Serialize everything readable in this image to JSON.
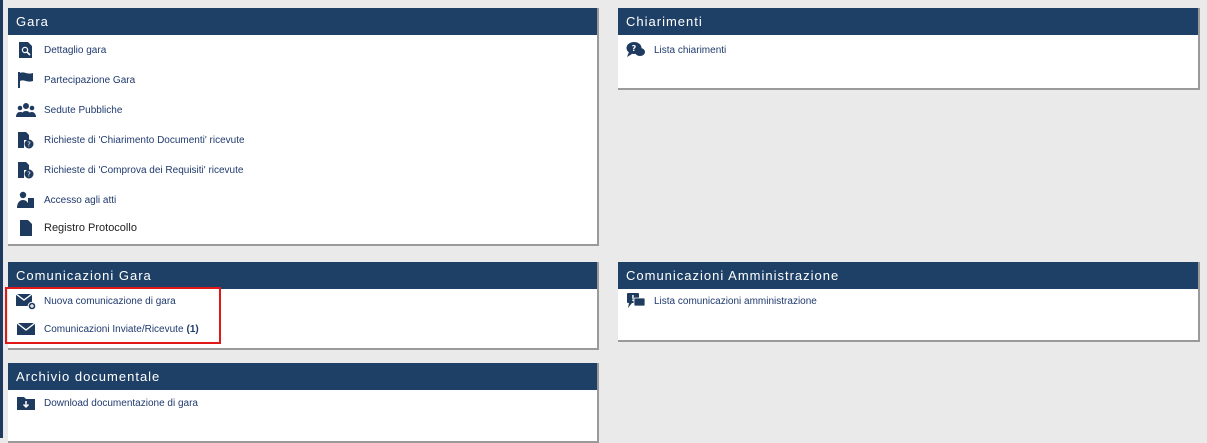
{
  "gara": {
    "title": "Gara",
    "items": [
      {
        "label": "Dettaglio gara",
        "icon": "magnifier-document-icon"
      },
      {
        "label": "Partecipazione Gara",
        "icon": "flag-icon"
      },
      {
        "label": "Sedute Pubbliche",
        "icon": "users-group-icon"
      },
      {
        "label": "Richieste di 'Chiarimento Documenti' ricevute",
        "icon": "document-question-icon"
      },
      {
        "label": "Richieste di 'Comprova dei Requisiti' ricevute",
        "icon": "document-question-icon"
      },
      {
        "label": "Accesso agli atti",
        "icon": "user-document-icon"
      },
      {
        "label": "Registro Protocollo",
        "icon": "document-icon"
      }
    ]
  },
  "chiarimenti": {
    "title": "Chiarimenti",
    "items": [
      {
        "label": "Lista chiarimenti",
        "icon": "question-chat-icon"
      }
    ]
  },
  "comunicazioni_gara": {
    "title": "Comunicazioni Gara",
    "items": [
      {
        "label": "Nuova comunicazione di gara",
        "icon": "envelope-plus-icon"
      },
      {
        "label": "Comunicazioni Inviate/Ricevute",
        "count": "(1)",
        "icon": "envelope-icon"
      }
    ]
  },
  "comunicazioni_amministrazione": {
    "title": "Comunicazioni Amministrazione",
    "items": [
      {
        "label": "Lista comunicazioni amministrazione",
        "icon": "info-chat-icon"
      }
    ]
  },
  "archivio": {
    "title": "Archivio documentale",
    "items": [
      {
        "label": "Download documentazione di gara",
        "icon": "folder-download-icon"
      }
    ]
  },
  "colors": {
    "header": "#1f4066",
    "link": "#1f3a6e",
    "highlight": "#e01818",
    "background": "#eaeaea"
  }
}
